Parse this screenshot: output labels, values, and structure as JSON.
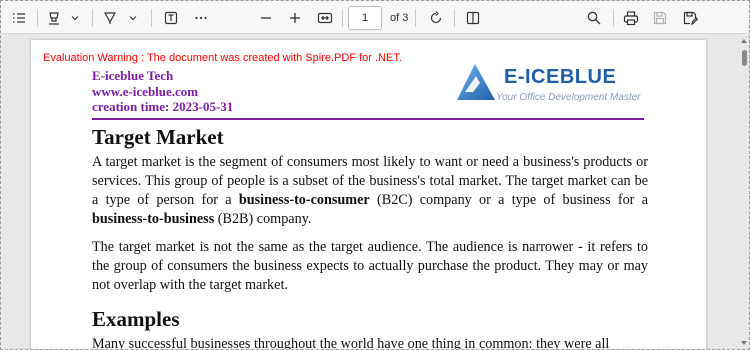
{
  "toolbar": {
    "page_current": "1",
    "page_of": "of 3",
    "icons": [
      "contents-icon",
      "highlight-icon",
      "chevron-down-icon",
      "draw-icon",
      "chevron-down-icon",
      "text-icon",
      "more-icon",
      "zoom-out-icon",
      "zoom-in-icon",
      "fit-width-icon",
      "rotate-icon",
      "two-page-icon",
      "search-icon",
      "print-icon",
      "save-icon",
      "save-as-icon"
    ]
  },
  "document": {
    "warning": "Evaluation Warning : The document was created with Spire.PDF for .NET.",
    "header": {
      "company": "E-iceblue Tech",
      "website": "www.e-iceblue.com",
      "creation": "creation time: 2023-05-31"
    },
    "logo": {
      "word": "E-ICEBLUE",
      "tagline": "Your Office Development Master"
    },
    "heading1": "Target Market",
    "para1": {
      "a": "A target market is the segment of consumers most likely to want or need a business's products or services. This group of people is a subset of the business's total market. The target market can be a type of person for a ",
      "b1": "business-to-consumer",
      "c": " (B2C) company or a type of business for a ",
      "b2": "business-to-business",
      "d": " (B2B) company."
    },
    "para2": "The target market is not the same as the target audience. The audience is narrower - it refers to the group of consumers the business expects to actually purchase the product. They may or may not overlap with the target market.",
    "heading2": "Examples",
    "para3": "Many successful businesses throughout the world have one thing in common: they were all"
  },
  "colors": {
    "warning": "#ff0000",
    "header_purple": "#7b1fa2",
    "logo_blue": "#1f5fa8"
  }
}
